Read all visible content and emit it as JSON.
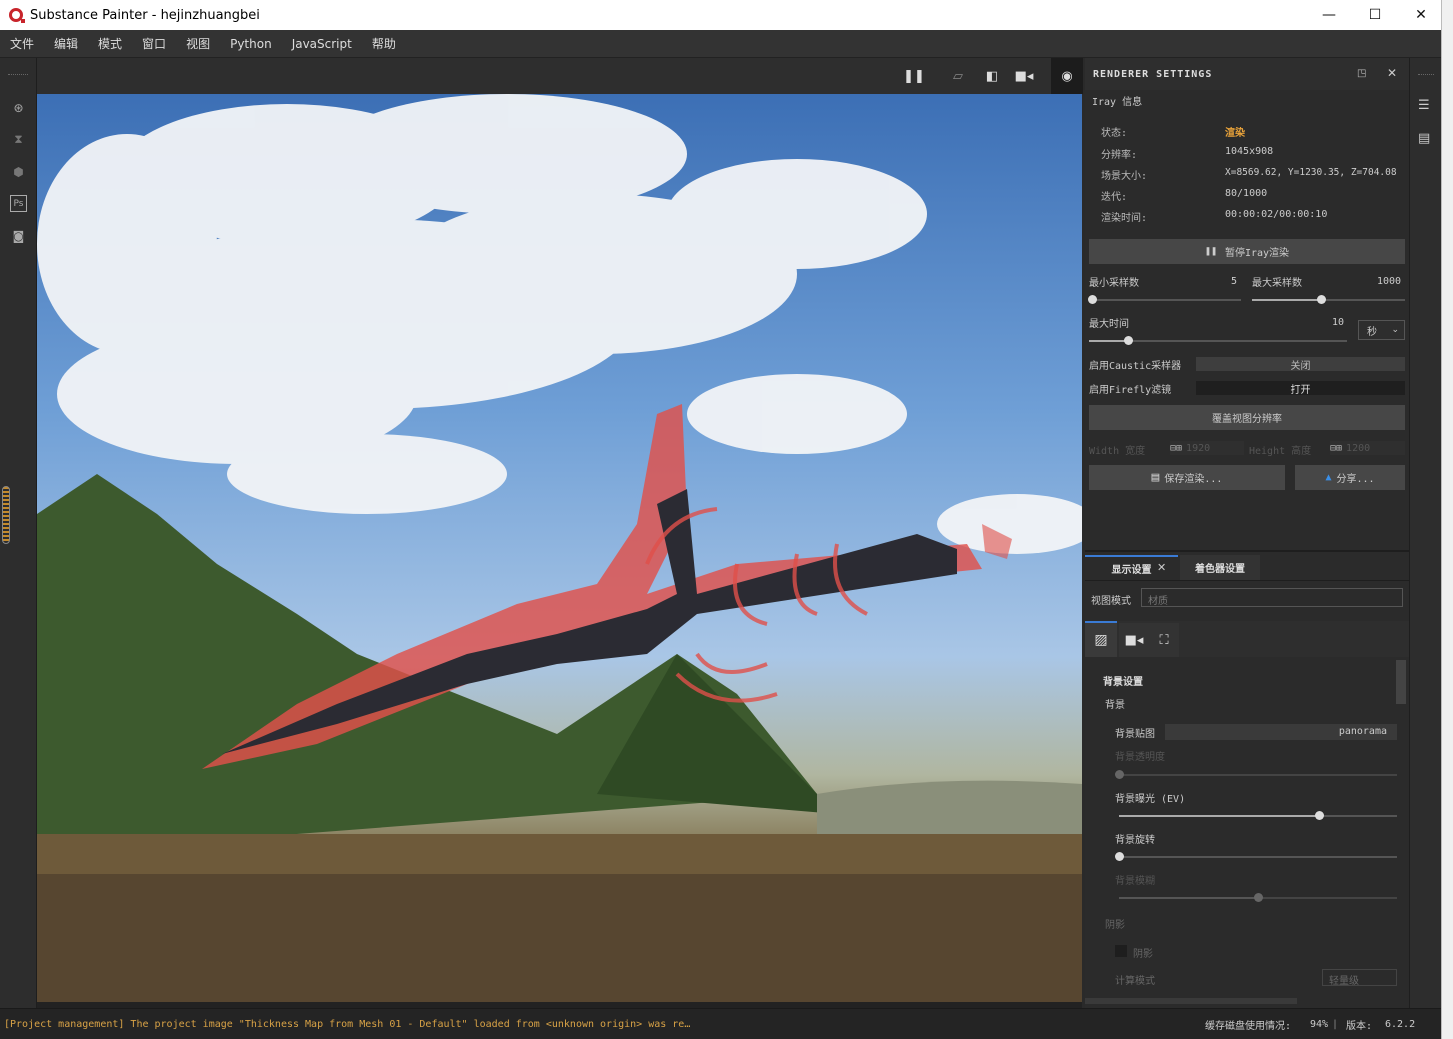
{
  "window": {
    "title": "Substance Painter - hejinzhuangbei",
    "minimize": "—",
    "maximize": "☐",
    "close": "✕"
  },
  "menu": [
    "文件",
    "编辑",
    "模式",
    "窗口",
    "视图",
    "Python",
    "JavaScript",
    "帮助"
  ],
  "renderer": {
    "title": "RENDERER SETTINGS",
    "section": "Iray 信息",
    "state_label": "状态:",
    "state_value": "渲染",
    "res_label": "分辨率:",
    "res_value": "1045x908",
    "scene_label": "场景大小:",
    "scene_value": "X=8569.62,  Y=1230.35,  Z=704.08",
    "iter_label": "迭代:",
    "iter_value": "80/1000",
    "time_label": "渲染时间:",
    "time_value": "00:00:02/00:00:10",
    "pause_button": "暂停Iray渲染",
    "min_samples_label": "最小采样数",
    "min_samples": "5",
    "min_samples_level": 0.02,
    "max_samples_label": "最大采样数",
    "max_samples": "1000",
    "max_samples_level": 0.45,
    "max_time_label": "最大时间",
    "max_time": "10",
    "max_time_level": 0.15,
    "time_unit": "秒",
    "caustic_label": "启用Caustic采样器",
    "caustic_value": "关闭",
    "firefly_label": "启用Firefly滤镜",
    "firefly_value": "打开",
    "override_button": "覆盖视图分辨率",
    "width_label": "Width 宽度",
    "width_value": "1920",
    "height_label": "Height 高度",
    "height_value": "1200",
    "save_button": "保存渲染...",
    "share_button": "分享..."
  },
  "display": {
    "tab1": "显示设置",
    "tab2": "着色器设置",
    "view_mode_label": "视图模式",
    "view_mode_value": "材质",
    "bg_settings": "背景设置",
    "bg": "背景",
    "bg_map_label": "背景贴图",
    "bg_map_value": "panorama",
    "bg_opacity_label": "背景透明度",
    "bg_opacity_level": 0.0,
    "bg_exposure_label": "背景曝光 (EV)",
    "bg_exposure_level": 0.72,
    "bg_rotation_label": "背景旋转",
    "bg_rotation_level": 0.0,
    "bg_blur_label": "背景模糊",
    "bg_blur_level": 0.5,
    "shadow_section": "阴影",
    "shadow_label": "阴影",
    "calc_mode_label": "计算模式",
    "calc_mode_value": "轻量级"
  },
  "status": {
    "log": "[Project management] The project image \"Thickness Map from Mesh 01 - Default\" loaded from <unknown origin> was re…",
    "cache_label": "缓存磁盘使用情况:",
    "cache_value": "94%",
    "version_label": "版本:",
    "version_value": "6.2.2"
  },
  "colors": {
    "accent_orange": "#e8a23a",
    "log_orange": "#d8a246",
    "active_tab": "#3a7bd5",
    "weapon_red": "#e0504a"
  }
}
